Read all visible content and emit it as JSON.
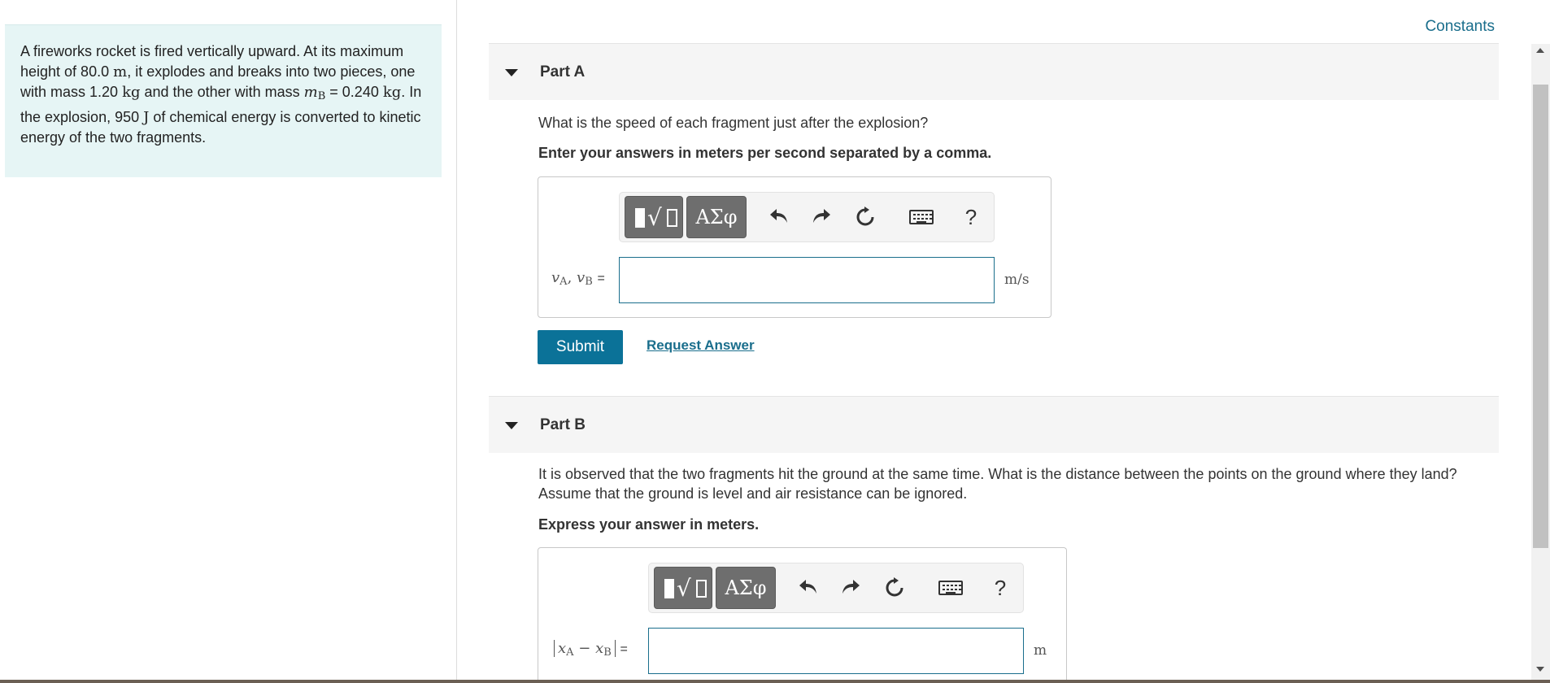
{
  "problem": {
    "text_1": "A fireworks rocket is fired vertically upward. At its maximum height of 80.0",
    "unit_m": "m",
    "text_2": ", it explodes and breaks into two pieces, one with mass 1.20",
    "unit_kg1": "kg",
    "text_3": " and the other with mass",
    "mass_var": "m",
    "mass_sub": "B",
    "text_4": " = 0.240",
    "unit_kg2": "kg",
    "text_5": ". In the explosion, 950",
    "unit_J": "J",
    "text_6": " of chemical energy is converted to kinetic energy of the two fragments."
  },
  "header": {
    "constants_label": "Constants"
  },
  "part_a": {
    "title": "Part A",
    "question": "What is the speed of each fragment just after the explosion?",
    "instruction": "Enter your answers in meters per second separated by a comma.",
    "greek_label": "ΑΣφ",
    "help_label": "?",
    "var_v": "v",
    "sub_a": "A",
    "comma": ", ",
    "sub_b": "B",
    "equals": "=",
    "answer_value": "",
    "unit": "m/s",
    "submit_label": "Submit",
    "request_label": "Request Answer"
  },
  "part_b": {
    "title": "Part B",
    "question": "It is observed that the two fragments hit the ground at the same time. What is the distance between the points on the ground where they land? Assume that the ground is level and air resistance can be ignored.",
    "instruction": "Express your answer in meters.",
    "greek_label": "ΑΣφ",
    "help_label": "?",
    "var_x": "x",
    "sub_a": "A",
    "minus": " − ",
    "sub_b": "B",
    "equals": "=",
    "answer_value": "",
    "unit": "m"
  },
  "colors": {
    "accent": "#0b7298",
    "panel_bg": "#e6f5f5",
    "link": "#1a6e8c"
  }
}
